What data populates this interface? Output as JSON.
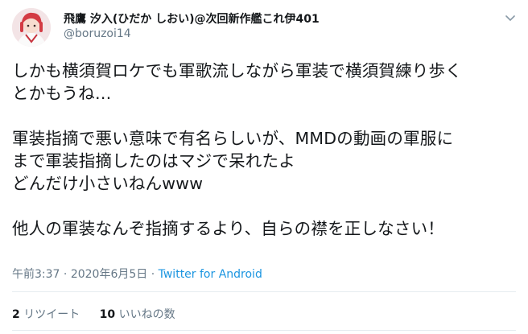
{
  "tweet": {
    "display_name": "飛鷹 汐入(ひだか しおい)@次回新作艦これ伊401",
    "handle": "@boruzoi14",
    "text_lines": [
      "しかも横須賀ロケでも軍歌流しながら軍装で横須賀練り歩く",
      "とかもうね…",
      "軍装指摘で悪い意味で有名らしいが、MMDの動画の軍服に",
      "まで軍装指摘したのはマジで呆れたよ",
      "どんだけ小さいねんwww",
      "他人の軍装なんぞ指摘するより、自らの襟を正しなさい！"
    ],
    "time": "午前3:37",
    "separator": "·",
    "date": "2020年6月5日",
    "source": "Twitter for Android",
    "retweet_count": "2",
    "retweet_label": "リツイート",
    "like_count": "10",
    "like_label": "いいねの数"
  },
  "icons": {
    "menu": "chevron-down-icon",
    "avatar": "avatar"
  },
  "colors": {
    "secondary": "#657786",
    "link": "#1b95e0",
    "divider": "#e6ecf0"
  }
}
